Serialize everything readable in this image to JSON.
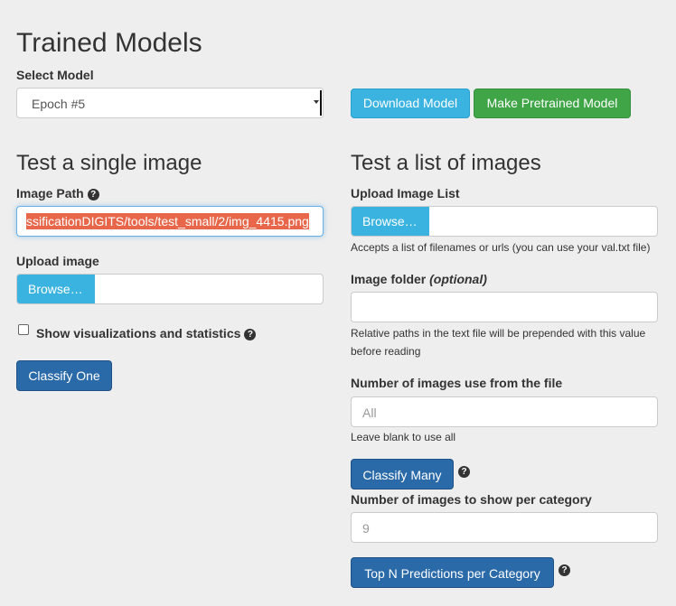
{
  "page": {
    "title": "Trained Models"
  },
  "model": {
    "select_label": "Select Model",
    "selected": "Epoch #5",
    "download_button": "Download Model",
    "pretrained_button": "Make Pretrained Model"
  },
  "single": {
    "heading": "Test a single image",
    "image_path_label": "Image Path",
    "image_path_value": "ssificationDIGITS/tools/test_small/2/img_4415.png",
    "upload_label": "Upload image",
    "browse_label": "Browse…",
    "show_viz_label": "Show visualizations and statistics",
    "classify_button": "Classify One"
  },
  "list": {
    "heading": "Test a list of images",
    "upload_label": "Upload Image List",
    "browse_label": "Browse…",
    "upload_hint": "Accepts a list of filenames or urls (you can use your val.txt file)",
    "folder_label": "Image folder",
    "folder_optional": "(optional)",
    "folder_hint_1": "Relative paths in the text file will be prepended with this value",
    "folder_hint_2": "before reading",
    "num_label": "Number of images use from the file",
    "num_placeholder": "All",
    "num_hint": "Leave blank to use all",
    "classify_button": "Classify Many",
    "per_cat_label": "Number of images to show per category",
    "per_cat_placeholder": "9",
    "topn_button": "Top N Predictions per Category"
  },
  "icons": {
    "help": "question-circle-icon"
  },
  "colors": {
    "background": "#eeeeee",
    "info": "#3bb3e0",
    "success": "#3fa547",
    "primary": "#2a6aa8",
    "selection": "#e8674a",
    "focus": "#66afe9"
  }
}
